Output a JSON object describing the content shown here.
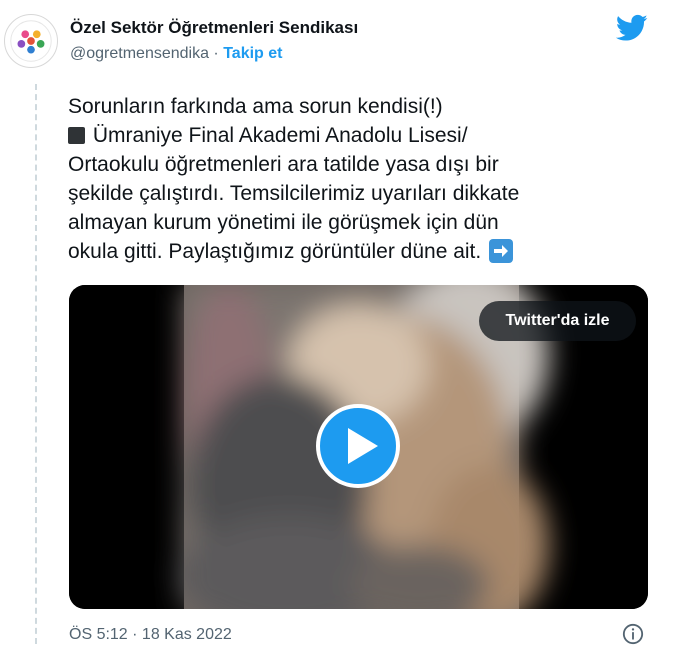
{
  "profile": {
    "display_name": "Özel Sektör Öğretmenleri Sendikası",
    "handle": "@ogretmensendika",
    "separator": " · ",
    "follow_label": "Takip et",
    "avatar_icon": "union-logo-icon"
  },
  "tweet": {
    "line1": "Sorunların farkında ama sorun kendisi(!)",
    "line2": "Ümraniye Final Akademi Anadolu Lisesi/",
    "body": "Ortaokulu öğretmenleri ara tatilde yasa dışı bir\nşekilde çalıştırdı. Temsilcilerimiz uyarıları dikkate\nalmayan kurum yönetimi ile görüşmek için dün\nokula gitti. Paylaştığımız görüntüler düne ait.",
    "bullet_icon": "black-square-icon",
    "arrow_icon": "right-arrow-icon"
  },
  "video": {
    "watch_label": "Twitter'da izle",
    "play_icon": "play-icon"
  },
  "footer": {
    "timestamp": "ÖS 5:12 · 18 Kas 2022",
    "info_icon": "info-icon"
  },
  "colors": {
    "accent": "#1d9bf0",
    "text": "#0f1419",
    "muted": "#536471"
  }
}
